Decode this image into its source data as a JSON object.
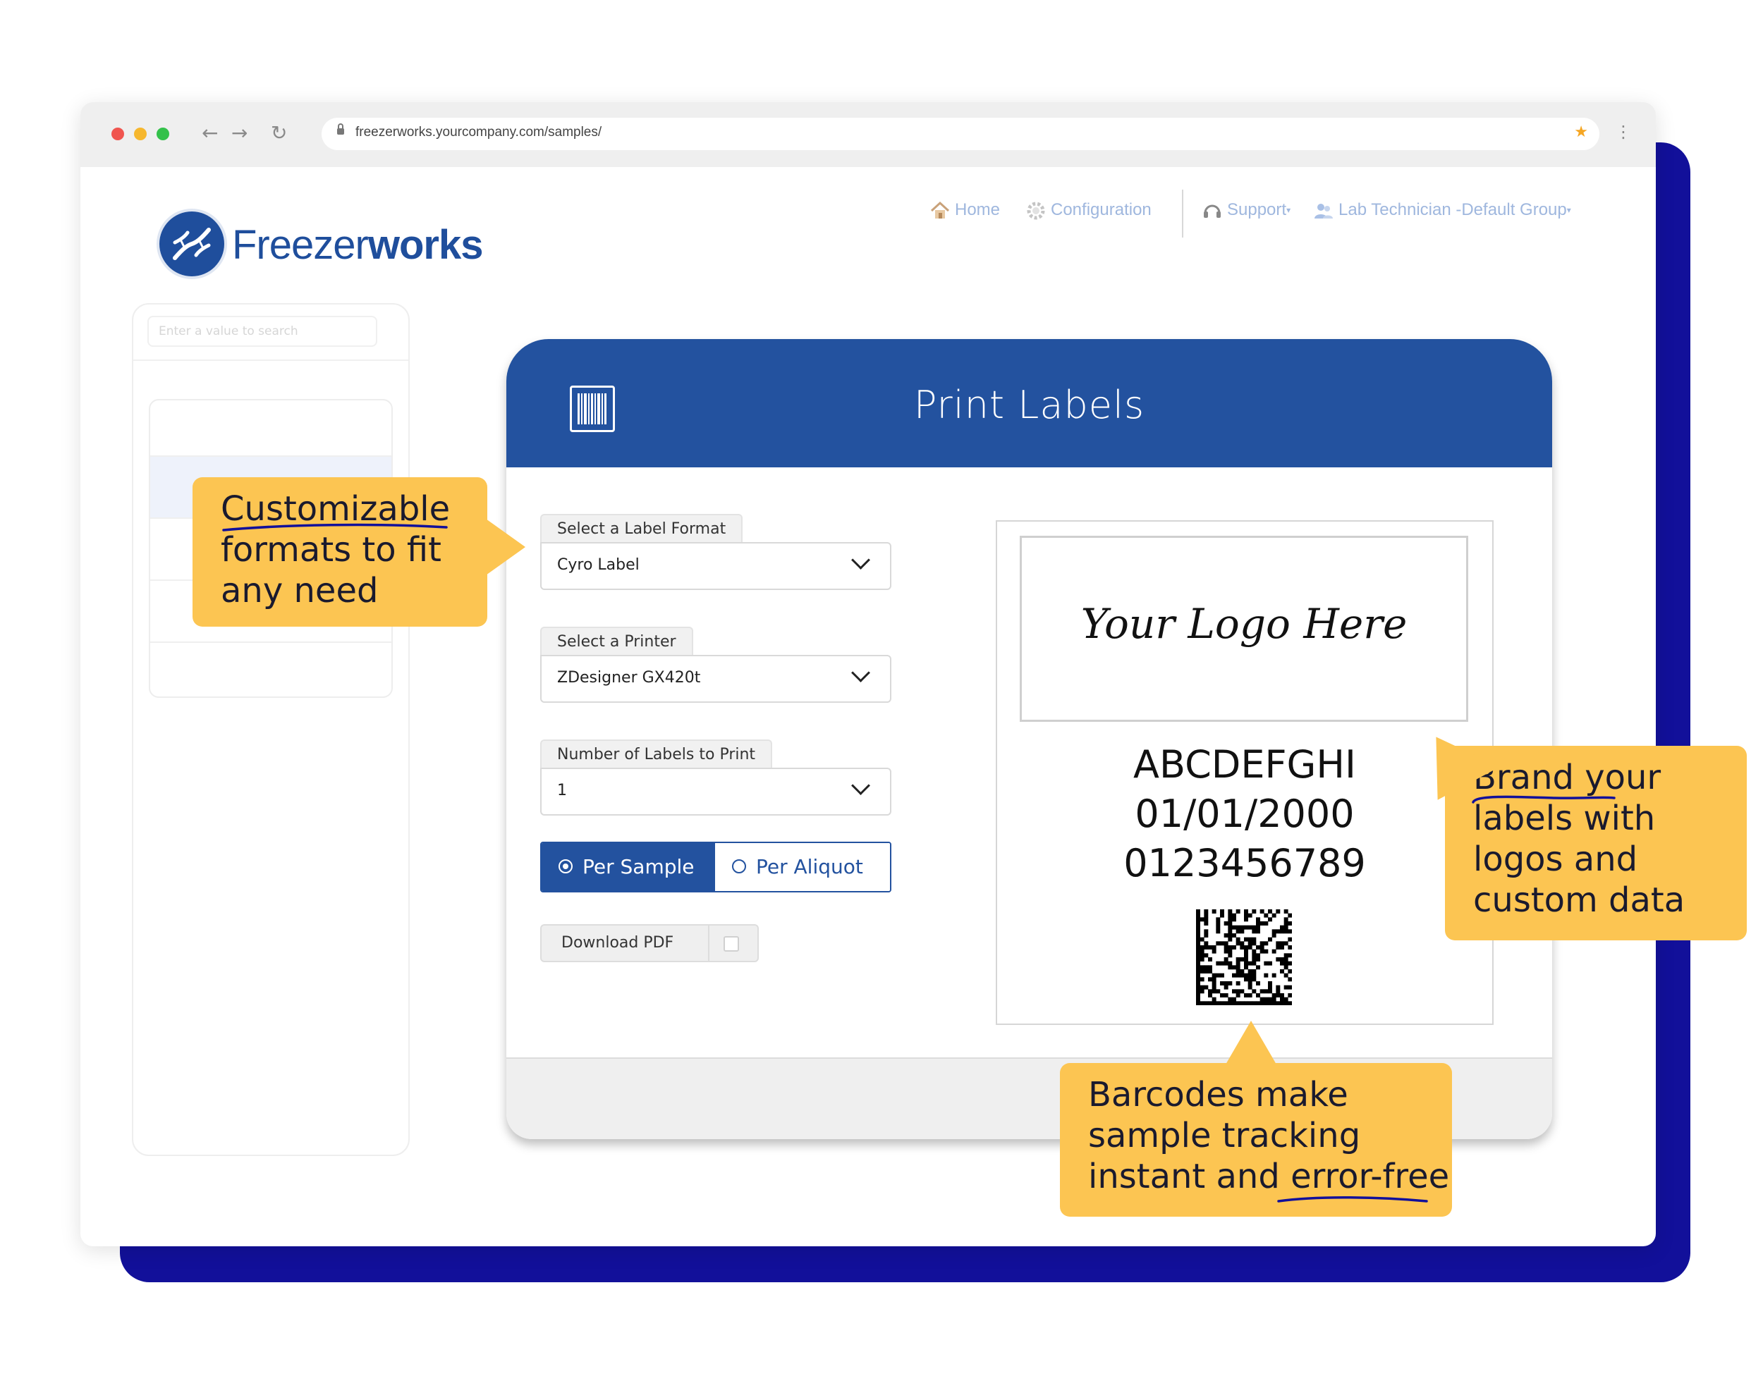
{
  "browser": {
    "url": "freezerworks.yourcompany.com/samples/"
  },
  "brand": {
    "name_light": "Freezer",
    "name_bold": "works",
    "color": "#1f4e9c"
  },
  "topnav": {
    "home": "Home",
    "configuration": "Configuration",
    "support": "Support",
    "user": "Lab Technician -Default Group"
  },
  "sidebar": {
    "search_placeholder": "Enter a value to search"
  },
  "panel": {
    "title": "Print Labels",
    "label_format": {
      "label": "Select a Label Format",
      "value": "Cyro Label"
    },
    "printer": {
      "label": "Select a Printer",
      "value": "ZDesigner GX420t"
    },
    "count": {
      "label": "Number of Labels to Print",
      "value": "1"
    },
    "mode": {
      "selected": "Per Sample",
      "other": "Per Aliquot"
    },
    "download_pdf": "Download PDF",
    "accent": "#23529f"
  },
  "preview": {
    "logo_placeholder": "Your Logo Here",
    "line1": "ABCDEFGHI",
    "line2": "01/01/2000",
    "line3": "0123456789"
  },
  "callouts": {
    "formats": "Customizable\nformats to fit\nany need",
    "branding": "Brand your\nlabels with\nlogos and\ncustom data",
    "barcodes": "Barcodes make\nsample tracking\ninstant and error-free",
    "color": "#fcc552"
  },
  "colors": {
    "backdrop": "#12109a",
    "underline": "#12109a"
  }
}
